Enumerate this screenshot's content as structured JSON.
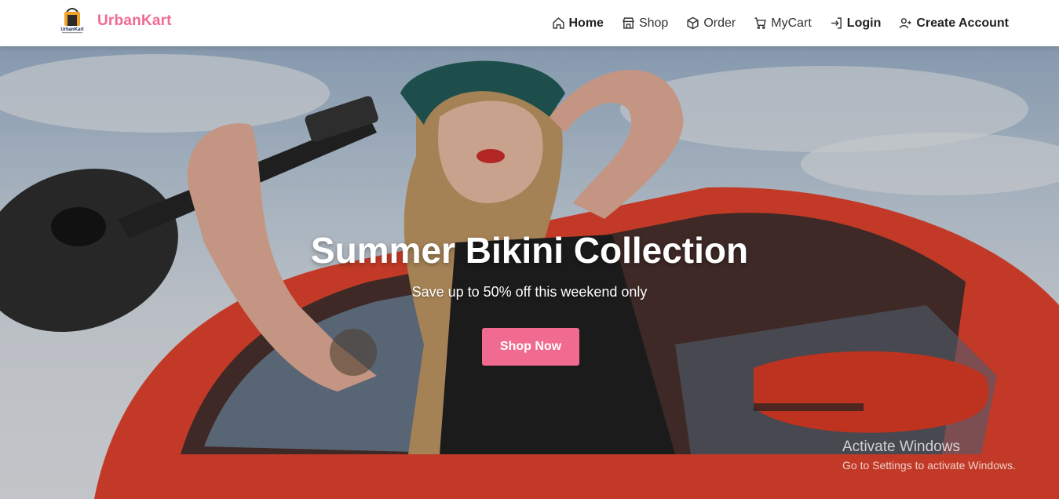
{
  "brand": {
    "name": "UrbanKart",
    "logo_text": "UrbanKart",
    "colors": {
      "accent": "#f06b8f"
    }
  },
  "nav": {
    "items": [
      {
        "label": "Home",
        "icon": "home-icon",
        "active": true
      },
      {
        "label": "Shop",
        "icon": "store-icon"
      },
      {
        "label": "Order",
        "icon": "box-icon"
      },
      {
        "label": "MyCart",
        "icon": "cart-icon"
      },
      {
        "label": "Login",
        "icon": "login-icon"
      },
      {
        "label": "Create Account",
        "icon": "user-plus-icon"
      }
    ]
  },
  "hero": {
    "title": "Summer Bikini Collection",
    "subtitle": "Save up to 50% off this weekend only",
    "cta_label": "Shop Now"
  },
  "watermark": {
    "title": "Activate Windows",
    "subtitle": "Go to Settings to activate Windows."
  }
}
